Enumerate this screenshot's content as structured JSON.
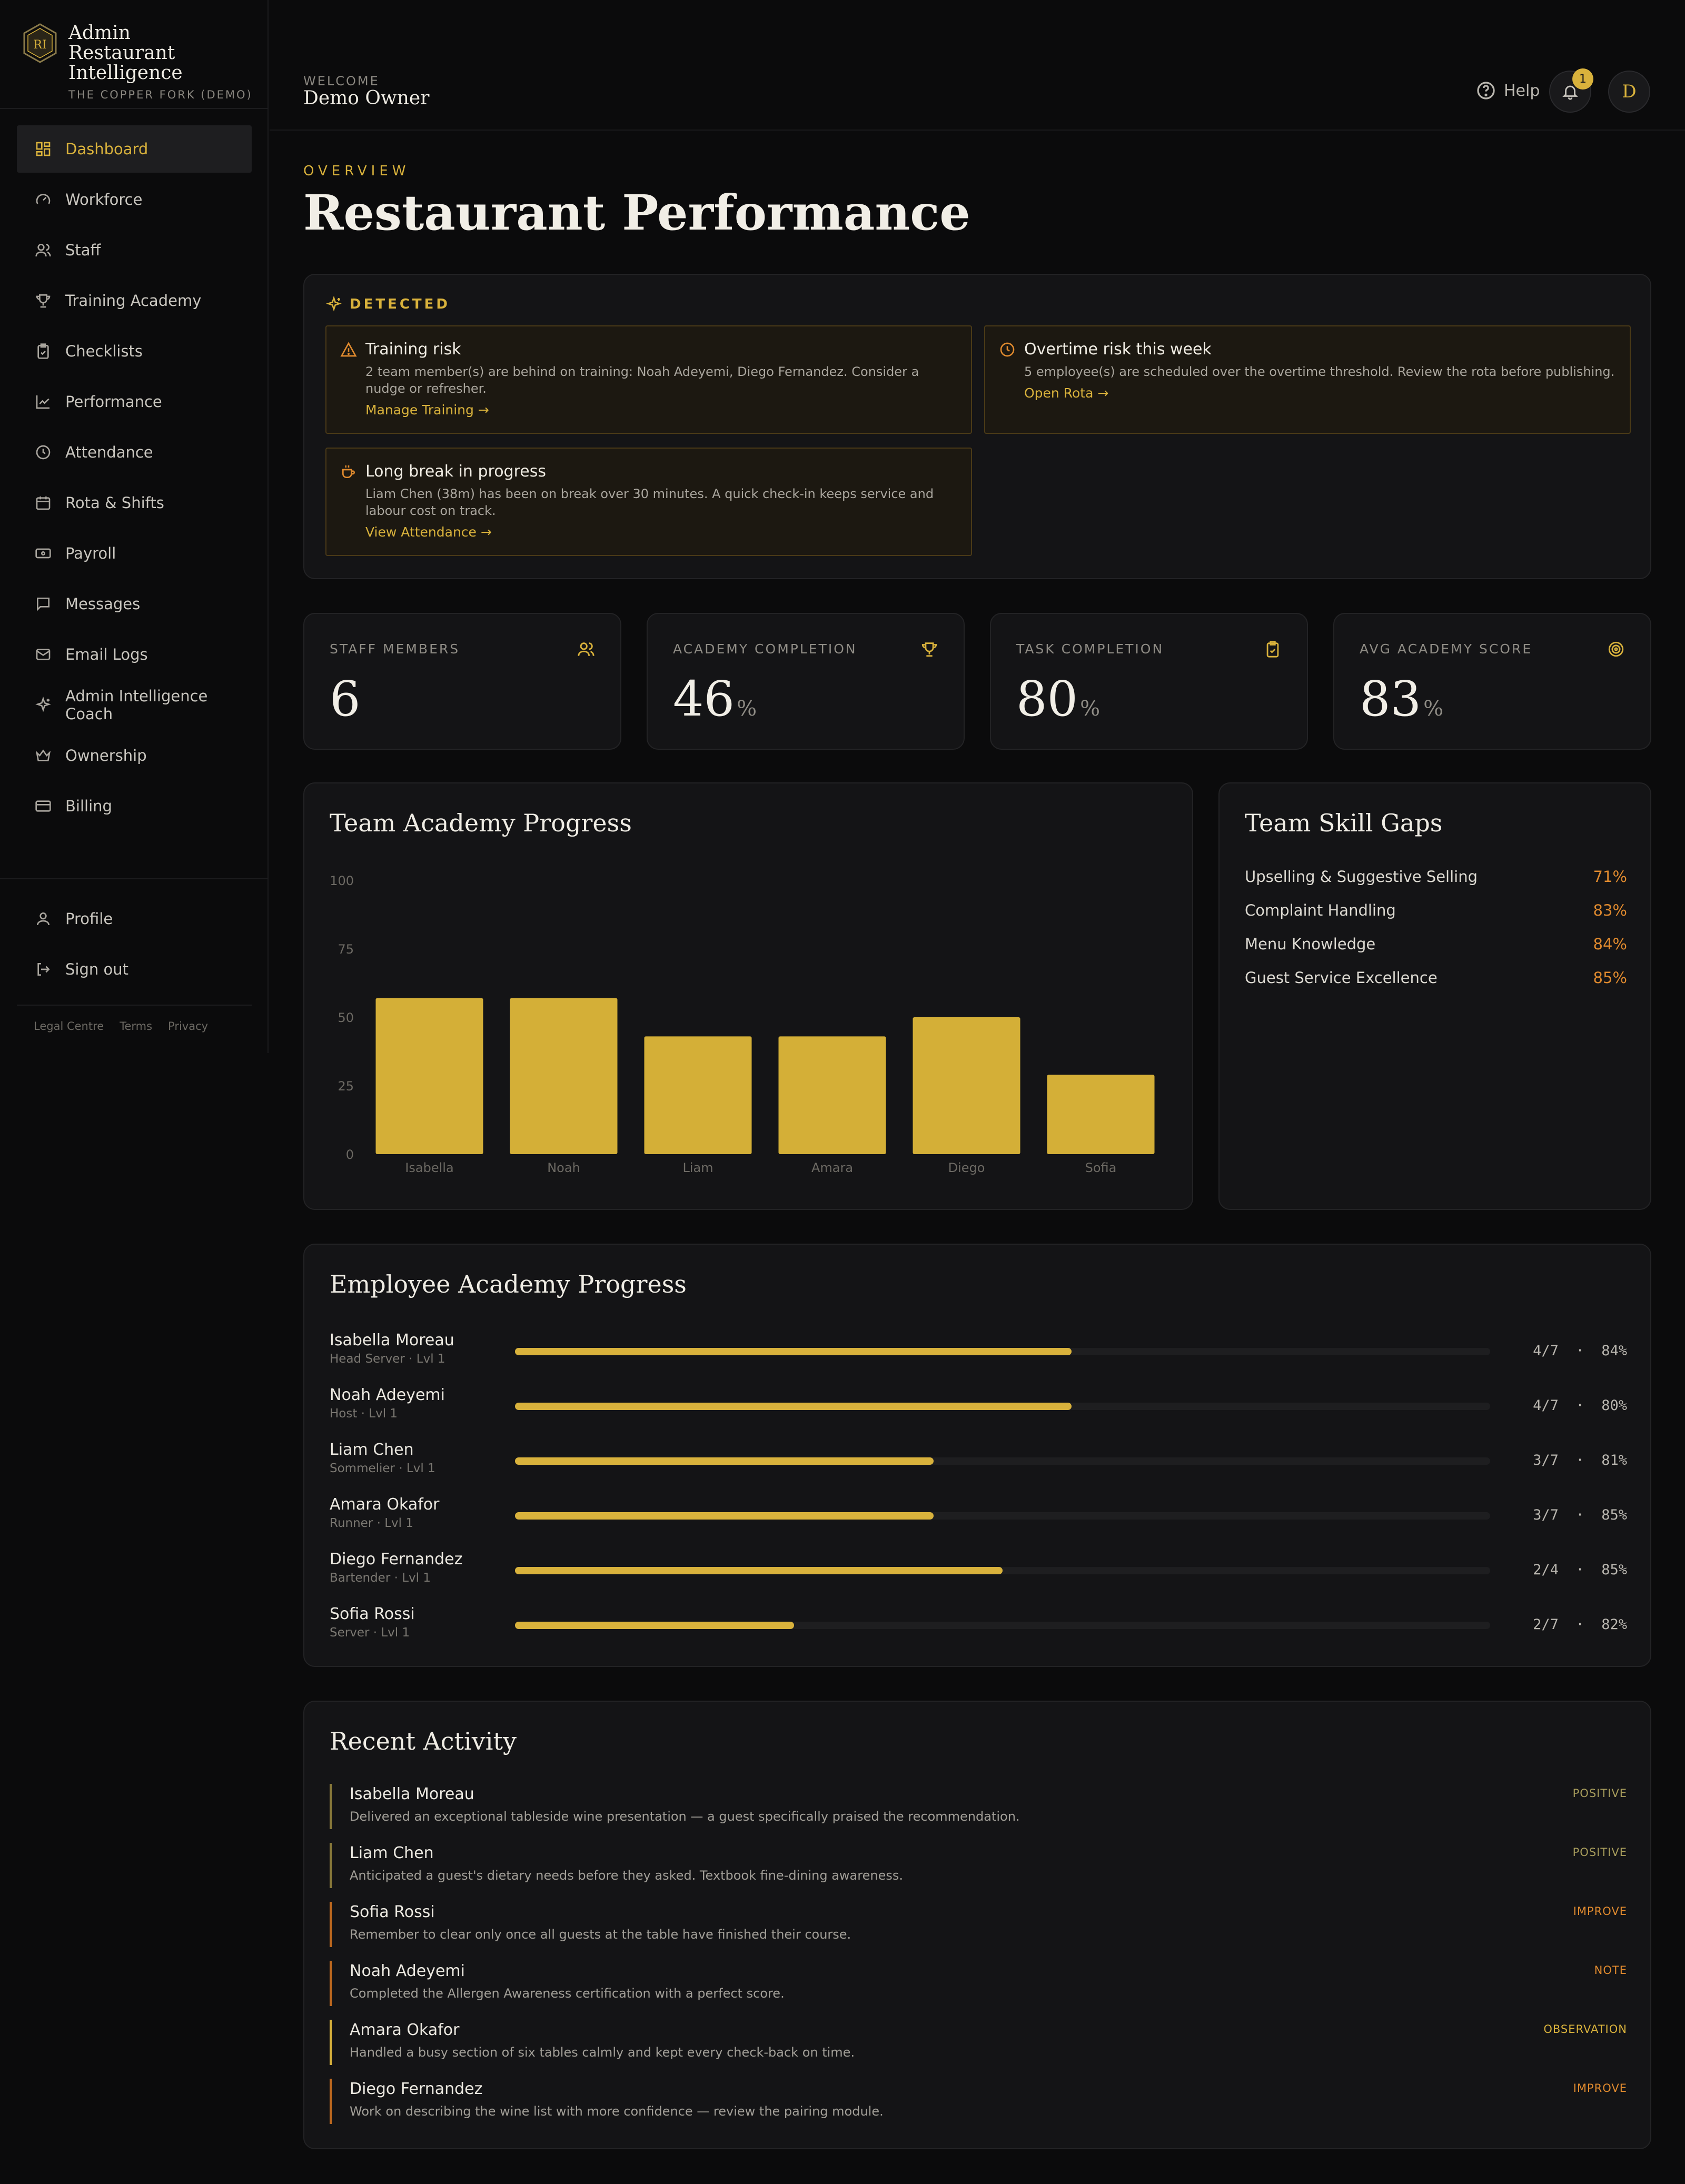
{
  "brand": {
    "title": "Admin Restaurant Intelligence",
    "subtitle": "THE COPPER FORK (DEMO)"
  },
  "sidebar": {
    "items": [
      {
        "label": "Dashboard",
        "icon": "dashboard-icon",
        "active": true
      },
      {
        "label": "Workforce",
        "icon": "gauge-icon"
      },
      {
        "label": "Staff",
        "icon": "users-icon"
      },
      {
        "label": "Training Academy",
        "icon": "trophy-icon"
      },
      {
        "label": "Checklists",
        "icon": "clipboard-check-icon"
      },
      {
        "label": "Performance",
        "icon": "line-chart-icon"
      },
      {
        "label": "Attendance",
        "icon": "clock-icon"
      },
      {
        "label": "Rota & Shifts",
        "icon": "calendar-icon"
      },
      {
        "label": "Payroll",
        "icon": "banknote-icon"
      },
      {
        "label": "Messages",
        "icon": "message-icon"
      },
      {
        "label": "Email Logs",
        "icon": "mail-icon"
      },
      {
        "label": "Admin Intelligence Coach",
        "icon": "sparkles-icon"
      },
      {
        "label": "Ownership",
        "icon": "crown-icon"
      },
      {
        "label": "Billing",
        "icon": "credit-card-icon"
      }
    ],
    "bottom": [
      {
        "label": "Profile",
        "icon": "user-icon"
      },
      {
        "label": "Sign out",
        "icon": "logout-icon"
      }
    ],
    "legal": [
      "Legal Centre",
      "Terms",
      "Privacy"
    ]
  },
  "header": {
    "welcome_label": "WELCOME",
    "welcome_name": "Demo Owner",
    "help_label": "Help",
    "notification_count": "1",
    "avatar_initial": "D"
  },
  "overview": {
    "label": "OVERVIEW",
    "title": "Restaurant Performance"
  },
  "detected": {
    "label": "DETECTED",
    "alerts": [
      {
        "icon": "warning-icon",
        "title": "Training risk",
        "body": "2 team member(s) are behind on training: Noah Adeyemi, Diego Fernandez. Consider a nudge or refresher.",
        "link": "Manage Training →"
      },
      {
        "icon": "clock-icon",
        "title": "Overtime risk this week",
        "body": "5 employee(s) are scheduled over the overtime threshold. Review the rota before publishing.",
        "link": "Open Rota →"
      },
      {
        "icon": "coffee-icon",
        "title": "Long break in progress",
        "body": "Liam Chen (38m) has been on break over 30 minutes. A quick check-in keeps service and labour cost on track.",
        "link": "View Attendance →"
      }
    ]
  },
  "stats": [
    {
      "label": "STAFF MEMBERS",
      "value": "6",
      "unit": "",
      "icon": "users-icon"
    },
    {
      "label": "ACADEMY COMPLETION",
      "value": "46",
      "unit": "%",
      "icon": "trophy-icon"
    },
    {
      "label": "TASK COMPLETION",
      "value": "80",
      "unit": "%",
      "icon": "clipboard-check-icon"
    },
    {
      "label": "AVG ACADEMY SCORE",
      "value": "83",
      "unit": "%",
      "icon": "target-icon"
    }
  ],
  "team_progress": {
    "title": "Team Academy Progress"
  },
  "chart_data": {
    "type": "bar",
    "title": "Team Academy Progress",
    "categories": [
      "Isabella",
      "Noah",
      "Liam",
      "Amara",
      "Diego",
      "Sofia"
    ],
    "values": [
      57,
      57,
      43,
      43,
      50,
      29
    ],
    "ylim": [
      0,
      100
    ],
    "yticks": [
      0,
      25,
      50,
      75,
      100
    ],
    "bar_color": "#d4af37",
    "grid": false
  },
  "skill_gaps": {
    "title": "Team Skill Gaps",
    "items": [
      {
        "name": "Upselling & Suggestive Selling",
        "pct": "71%"
      },
      {
        "name": "Complaint Handling",
        "pct": "83%"
      },
      {
        "name": "Menu Knowledge",
        "pct": "84%"
      },
      {
        "name": "Guest Service Excellence",
        "pct": "85%"
      }
    ]
  },
  "employee_progress": {
    "title": "Employee Academy Progress",
    "rows": [
      {
        "name": "Isabella Moreau",
        "role": "Head Server · Lvl 1",
        "fraction": 0.571,
        "modules": "4/7",
        "score": "84%"
      },
      {
        "name": "Noah Adeyemi",
        "role": "Host · Lvl 1",
        "fraction": 0.571,
        "modules": "4/7",
        "score": "80%"
      },
      {
        "name": "Liam Chen",
        "role": "Sommelier · Lvl 1",
        "fraction": 0.429,
        "modules": "3/7",
        "score": "81%"
      },
      {
        "name": "Amara Okafor",
        "role": "Runner · Lvl 1",
        "fraction": 0.429,
        "modules": "3/7",
        "score": "85%"
      },
      {
        "name": "Diego Fernandez",
        "role": "Bartender · Lvl 1",
        "fraction": 0.5,
        "modules": "2/4",
        "score": "85%"
      },
      {
        "name": "Sofia Rossi",
        "role": "Server · Lvl 1",
        "fraction": 0.286,
        "modules": "2/7",
        "score": "82%"
      }
    ]
  },
  "recent_activity": {
    "title": "Recent Activity",
    "items": [
      {
        "name": "Isabella Moreau",
        "desc": "Delivered an exceptional tableside wine presentation — a guest specifically praised the recommendation.",
        "tag": "POSITIVE",
        "kind": "positive"
      },
      {
        "name": "Liam Chen",
        "desc": "Anticipated a guest's dietary needs before they asked. Textbook fine-dining awareness.",
        "tag": "POSITIVE",
        "kind": "positive"
      },
      {
        "name": "Sofia Rossi",
        "desc": "Remember to clear only once all guests at the table have finished their course.",
        "tag": "IMPROVE",
        "kind": "improve"
      },
      {
        "name": "Noah Adeyemi",
        "desc": "Completed the Allergen Awareness certification with a perfect score.",
        "tag": "NOTE",
        "kind": "note"
      },
      {
        "name": "Amara Okafor",
        "desc": "Handled a busy section of six tables calmly and kept every check-back on time.",
        "tag": "OBSERVATION",
        "kind": "observation"
      },
      {
        "name": "Diego Fernandez",
        "desc": "Work on describing the wine list with more confidence — review the pairing module.",
        "tag": "IMPROVE",
        "kind": "improve"
      }
    ]
  },
  "colors": {
    "accent": "#d9b23c",
    "warning": "#e08a2e",
    "background": "#0b0b0c",
    "card": "#141416"
  }
}
